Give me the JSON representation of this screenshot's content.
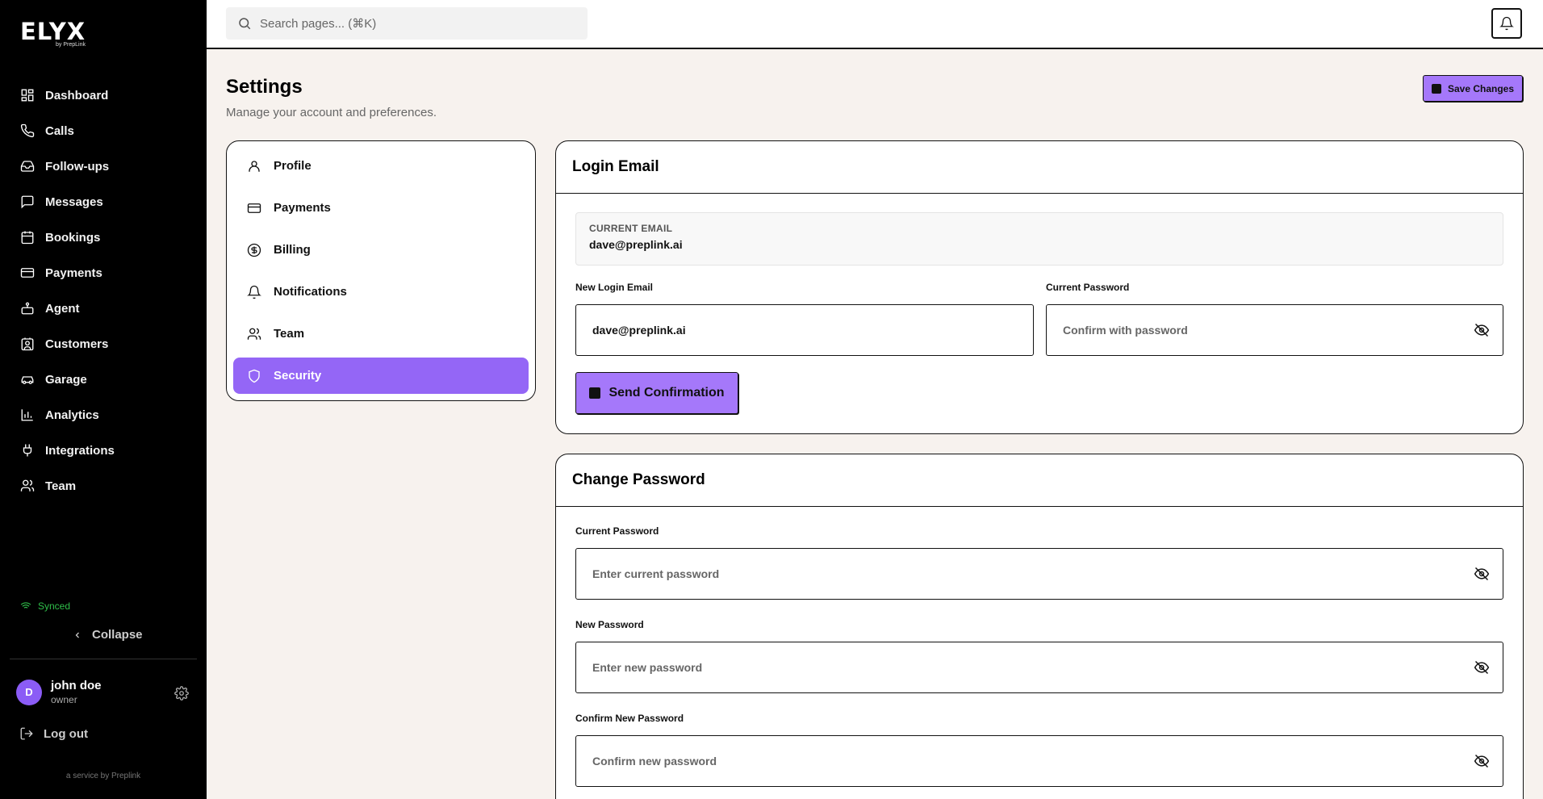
{
  "brand": {
    "logo": "ELYX",
    "byline": "by PrepLink",
    "service": "a service by Preplink"
  },
  "colors": {
    "accent": "#a578fa",
    "active": "#9466f6",
    "synced": "#2fbf4a"
  },
  "sidebar": {
    "items": [
      {
        "label": "Dashboard",
        "icon": "dashboard-icon"
      },
      {
        "label": "Calls",
        "icon": "phone-icon"
      },
      {
        "label": "Follow-ups",
        "icon": "inbox-icon"
      },
      {
        "label": "Messages",
        "icon": "message-icon"
      },
      {
        "label": "Bookings",
        "icon": "calendar-icon"
      },
      {
        "label": "Payments",
        "icon": "credit-card-icon"
      },
      {
        "label": "Agent",
        "icon": "bot-icon"
      },
      {
        "label": "Customers",
        "icon": "contact-icon"
      },
      {
        "label": "Garage",
        "icon": "car-icon"
      },
      {
        "label": "Analytics",
        "icon": "bar-chart-icon"
      },
      {
        "label": "Integrations",
        "icon": "plug-icon"
      },
      {
        "label": "Team",
        "icon": "users-icon"
      }
    ],
    "synced": "Synced",
    "collapse": "Collapse",
    "user": {
      "initial": "D",
      "name": "john doe",
      "role": "owner"
    },
    "logout": "Log out"
  },
  "topbar": {
    "search_placeholder": "Search pages... (⌘K)"
  },
  "page": {
    "title": "Settings",
    "subtitle": "Manage your account and preferences.",
    "save_label": "Save Changes"
  },
  "settings_nav": [
    {
      "label": "Profile",
      "icon": "user-icon",
      "active": false
    },
    {
      "label": "Payments",
      "icon": "credit-card-icon",
      "active": false
    },
    {
      "label": "Billing",
      "icon": "dollar-circle-icon",
      "active": false
    },
    {
      "label": "Notifications",
      "icon": "bell-icon",
      "active": false
    },
    {
      "label": "Team",
      "icon": "users-icon",
      "active": false
    },
    {
      "label": "Security",
      "icon": "shield-icon",
      "active": true
    }
  ],
  "login_email": {
    "title": "Login Email",
    "current_label": "CURRENT EMAIL",
    "current_value": "dave@preplink.ai",
    "new_label": "New Login Email",
    "new_value": "dave@preplink.ai",
    "password_label": "Current Password",
    "password_placeholder": "Confirm with password",
    "send_label": "Send Confirmation"
  },
  "change_password": {
    "title": "Change Password",
    "current_label": "Current Password",
    "current_placeholder": "Enter current password",
    "new_label": "New Password",
    "new_placeholder": "Enter new password",
    "confirm_label": "Confirm New Password",
    "confirm_placeholder": "Confirm new password"
  }
}
